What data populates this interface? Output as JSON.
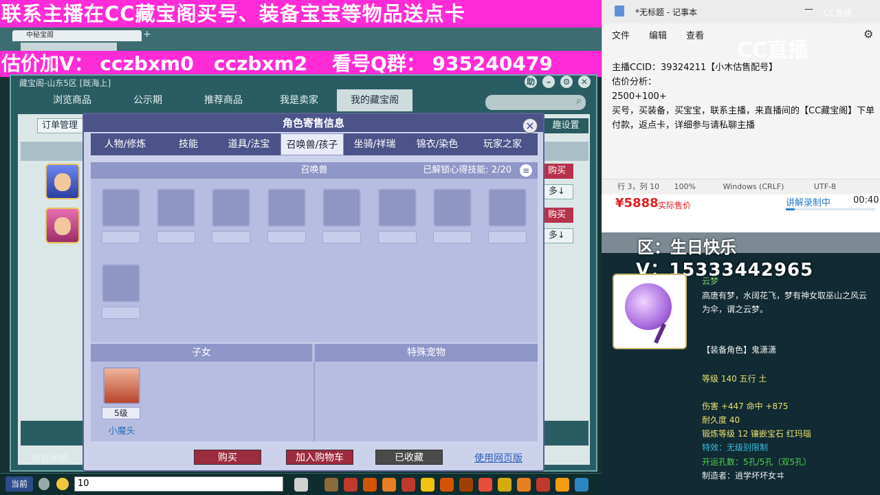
{
  "banners": {
    "top": "联系主播在CC藏宝阁买号、装备宝宝等物品送点卡",
    "middle_prefix": "估价加V：",
    "middle_ids": "cczbxm0   cczbxm2",
    "middle_qq_label": "看号Q群：",
    "middle_qq": "935240479"
  },
  "browser": {
    "tab_label": "中秘宝阁",
    "new_tab": "+"
  },
  "shop": {
    "title": "藏宝阁-山东5区 [既海上]",
    "help": "助",
    "tabs": [
      "浏览商品",
      "公示期",
      "推荐商品",
      "我是卖家",
      "我的藏宝阁"
    ],
    "active_tab": 4,
    "order_mgmt": "订单管理",
    "interest_settings": "趣设置",
    "buy_side": "购买",
    "more_side": "多↓",
    "wallet_label": "钱包余额:"
  },
  "modal": {
    "title": "角色寄售信息",
    "close": "✕",
    "tabs": [
      "人物/修炼",
      "技能",
      "道具/法宝",
      "召唤兽/孩子",
      "坐骑/祥瑞",
      "锦衣/染色",
      "玩家之家"
    ],
    "active_tab": 3,
    "pet_section_title": "召唤兽",
    "skill_label": "已解锁心得技能:",
    "skill_count": "2/20",
    "menu_icon": "≡",
    "child_section_title": "子女",
    "special_pet_title": "特殊宠物",
    "child": {
      "level": "5级",
      "name": "小魔头"
    },
    "buttons": {
      "buy": "购买",
      "cart": "加入购物车",
      "favorited": "已收藏",
      "web": "使用网页版"
    }
  },
  "gamebar": {
    "channel": "当前",
    "input_value": "10"
  },
  "notepad": {
    "title": "*无标题 - 记事本",
    "menu": [
      "文件",
      "编辑",
      "查看"
    ],
    "content": "主播CCID：39324211【小木估售配号】\n估价分析：\n2500+100+\n买号，买装备，买宝宝，联系主播，来直播间的【CC藏宝阁】下单付款，返点卡，详细参与请私聊主播",
    "status": {
      "position": "行 3，列 10",
      "zoom": "100%",
      "eol": "Windows (CRLF)",
      "encoding": "UTF-8"
    }
  },
  "cc": {
    "logo": "CC直播",
    "corner": "CC直播"
  },
  "price_strip": {
    "price": "¥5888",
    "price_note": "实际售价",
    "recording": "讲解录制中",
    "time": "00:40",
    "progress": 0.1
  },
  "item": {
    "zone_line": "区：生日快乐",
    "v_line": "V：15333442965",
    "name": "云梦",
    "description": "高唐有梦，水阔花飞，梦有神女取巫山之风云为伞，谓之云梦。",
    "role": "【装备角色】鬼潇潇",
    "level": "等级 140 五行 土",
    "damage": "伤害 +447 命中 +875",
    "durability": "耐久度 40",
    "forge": "锻炼等级 12 镶嵌宝石 红玛瑙",
    "effect": "特效：无级别限制",
    "holes": "开运孔数：5孔/5孔（双5孔）",
    "maker": "制造者：逍学坏坏女ヰ"
  },
  "colors": {
    "banner": "#ff2bd6",
    "modal_header": "#4b5389",
    "buy_red": "#9d2b3e",
    "price_red": "#e02020"
  }
}
